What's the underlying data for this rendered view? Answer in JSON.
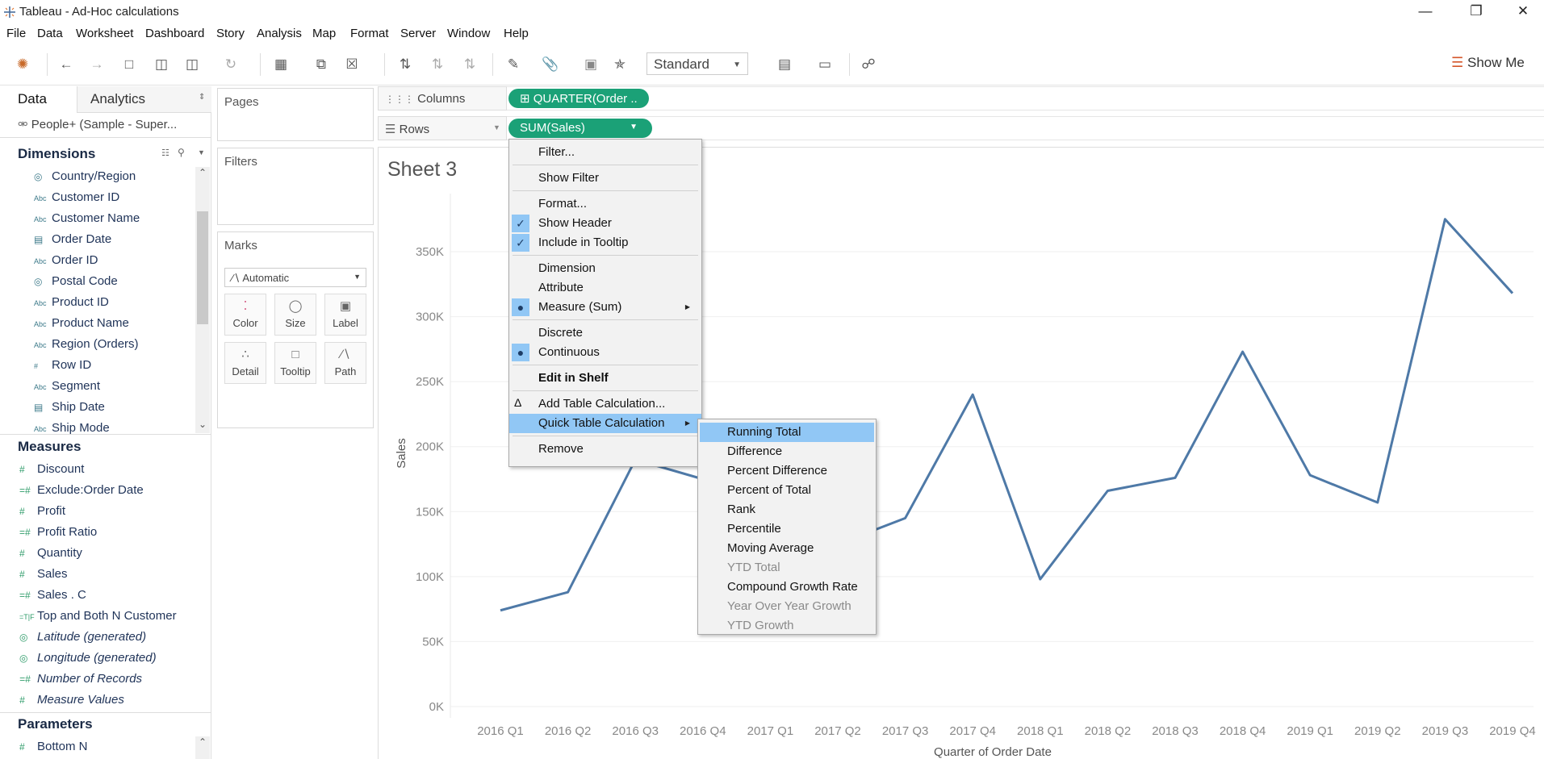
{
  "window": {
    "title": "Tableau - Ad-Hoc calculations"
  },
  "menubar": [
    "File",
    "Data",
    "Worksheet",
    "Dashboard",
    "Story",
    "Analysis",
    "Map",
    "Format",
    "Server",
    "Window",
    "Help"
  ],
  "toolbar": {
    "fit_select": "Standard",
    "show_me": "Show Me"
  },
  "data_pane": {
    "tabs": [
      "Data",
      "Analytics"
    ],
    "datasource": "People+ (Sample - Super...",
    "dimensions_header": "Dimensions",
    "dimensions": [
      {
        "icon": "globe-icon",
        "label": "Country/Region"
      },
      {
        "icon": "abc-icon",
        "label": "Customer ID"
      },
      {
        "icon": "abc-icon",
        "label": "Customer Name"
      },
      {
        "icon": "calendar-icon",
        "label": "Order Date"
      },
      {
        "icon": "abc-icon",
        "label": "Order ID"
      },
      {
        "icon": "globe-icon",
        "label": "Postal Code"
      },
      {
        "icon": "abc-icon",
        "label": "Product ID"
      },
      {
        "icon": "abc-icon",
        "label": "Product Name"
      },
      {
        "icon": "abc-icon",
        "label": "Region (Orders)"
      },
      {
        "icon": "hash-icon",
        "label": "Row ID"
      },
      {
        "icon": "abc-icon",
        "label": "Segment"
      },
      {
        "icon": "calendar-icon",
        "label": "Ship Date"
      },
      {
        "icon": "abc-icon",
        "label": "Ship Mode"
      }
    ],
    "measures_header": "Measures",
    "measures": [
      {
        "icon": "hash-icon",
        "label": "Discount",
        "italic": false
      },
      {
        "icon": "calc-hash-icon",
        "label": "Exclude:Order Date",
        "italic": false
      },
      {
        "icon": "hash-icon",
        "label": "Profit",
        "italic": false
      },
      {
        "icon": "calc-hash-icon",
        "label": "Profit Ratio",
        "italic": false
      },
      {
        "icon": "hash-icon",
        "label": "Quantity",
        "italic": false
      },
      {
        "icon": "hash-icon",
        "label": "Sales",
        "italic": false
      },
      {
        "icon": "calc-hash-icon",
        "label": "Sales . C",
        "italic": false
      },
      {
        "icon": "calc-tf-icon",
        "label": "Top and Both N Customer",
        "italic": false
      },
      {
        "icon": "globe-icon",
        "label": "Latitude (generated)",
        "italic": true
      },
      {
        "icon": "globe-icon",
        "label": "Longitude (generated)",
        "italic": true
      },
      {
        "icon": "calc-hash-icon",
        "label": "Number of Records",
        "italic": true
      },
      {
        "icon": "hash-icon",
        "label": "Measure Values",
        "italic": true
      }
    ],
    "parameters_header": "Parameters",
    "parameters": [
      {
        "icon": "hash-icon",
        "label": "Bottom N"
      }
    ]
  },
  "cards": {
    "pages": "Pages",
    "filters": "Filters",
    "marks": "Marks",
    "mark_type": "Automatic",
    "mark_buttons": [
      "Color",
      "Size",
      "Label",
      "Detail",
      "Tooltip",
      "Path"
    ]
  },
  "shelves": {
    "columns_label": "Columns",
    "rows_label": "Rows",
    "columns_pill": "QUARTER(Order ..",
    "rows_pill": "SUM(Sales)"
  },
  "sheet": {
    "title": "Sheet 3"
  },
  "context_menu": [
    {
      "label": "Filter...",
      "type": "item"
    },
    {
      "type": "sep"
    },
    {
      "label": "Show Filter",
      "type": "item"
    },
    {
      "type": "sep"
    },
    {
      "label": "Format...",
      "type": "item"
    },
    {
      "label": "Show Header",
      "type": "check"
    },
    {
      "label": "Include in Tooltip",
      "type": "check"
    },
    {
      "type": "sep"
    },
    {
      "label": "Dimension",
      "type": "item"
    },
    {
      "label": "Attribute",
      "type": "item"
    },
    {
      "label": "Measure (Sum)",
      "type": "radio",
      "submenu": true
    },
    {
      "type": "sep"
    },
    {
      "label": "Discrete",
      "type": "item"
    },
    {
      "label": "Continuous",
      "type": "radio"
    },
    {
      "type": "sep"
    },
    {
      "label": "Edit in Shelf",
      "type": "bold"
    },
    {
      "type": "sep"
    },
    {
      "label": "Add Table Calculation...",
      "type": "delta"
    },
    {
      "label": "Quick Table Calculation",
      "type": "selected",
      "submenu": true
    },
    {
      "type": "sep"
    },
    {
      "label": "Remove",
      "type": "item"
    }
  ],
  "submenu": [
    {
      "label": "Running Total",
      "state": "selected"
    },
    {
      "label": "Difference",
      "state": "enabled"
    },
    {
      "label": "Percent Difference",
      "state": "enabled"
    },
    {
      "label": "Percent of Total",
      "state": "enabled"
    },
    {
      "label": "Rank",
      "state": "enabled"
    },
    {
      "label": "Percentile",
      "state": "enabled"
    },
    {
      "label": "Moving Average",
      "state": "enabled"
    },
    {
      "label": "YTD Total",
      "state": "disabled"
    },
    {
      "label": "Compound Growth Rate",
      "state": "enabled"
    },
    {
      "label": "Year Over Year Growth",
      "state": "disabled"
    },
    {
      "label": "YTD Growth",
      "state": "disabled"
    }
  ],
  "chart_data": {
    "type": "line",
    "categories": [
      "2016 Q1",
      "2016 Q2",
      "2016 Q3",
      "2016 Q4",
      "2017 Q1",
      "2017 Q2",
      "2017 Q3",
      "2017 Q4",
      "2018 Q1",
      "2018 Q2",
      "2018 Q3",
      "2018 Q4",
      "2019 Q1",
      "2019 Q2",
      "2019 Q3",
      "2019 Q4"
    ],
    "series": [
      {
        "values": [
          74000,
          88000,
          190000,
          175000,
          118000,
          125000,
          145000,
          240000,
          98000,
          166000,
          176000,
          273000,
          178000,
          157000,
          375000,
          318000
        ]
      }
    ],
    "xlabel": "Quarter of Order Date",
    "ylabel": "Sales",
    "yticks": [
      "0K",
      "50K",
      "100K",
      "150K",
      "200K",
      "250K",
      "300K",
      "350K"
    ],
    "ylim": [
      0,
      400000
    ],
    "grid": true,
    "line_color": "#4e79a7"
  }
}
